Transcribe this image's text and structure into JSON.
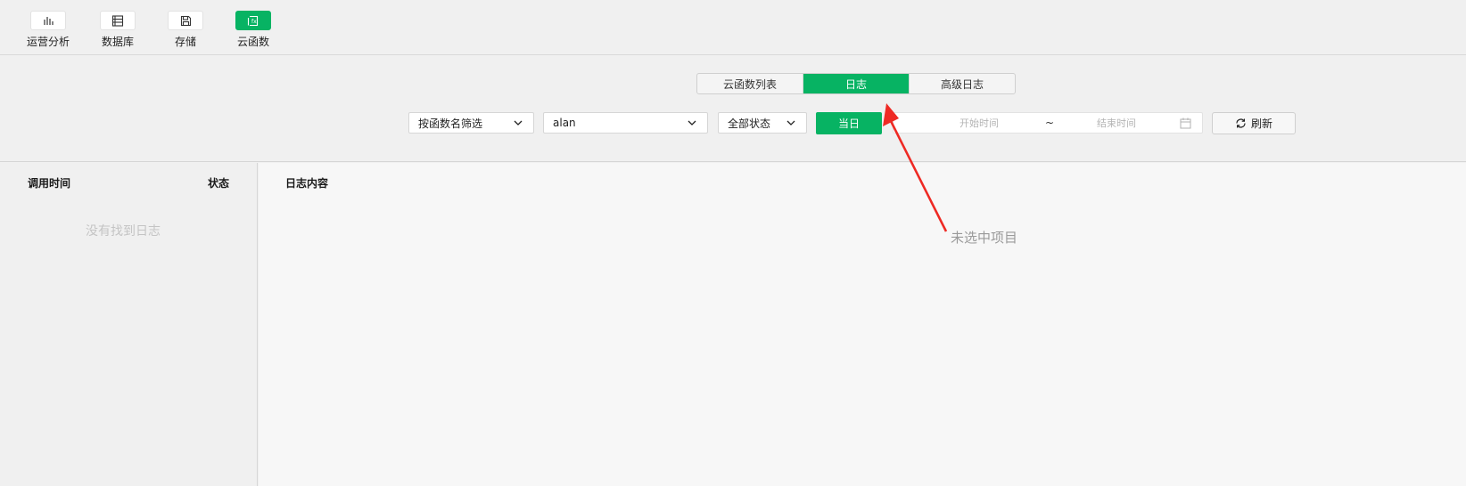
{
  "toolbar": {
    "items": [
      {
        "label": "运营分析",
        "icon": "bar-chart-icon"
      },
      {
        "label": "数据库",
        "icon": "database-icon"
      },
      {
        "label": "存储",
        "icon": "save-icon"
      },
      {
        "label": "云函数",
        "icon": "function-icon",
        "active": true
      }
    ]
  },
  "tabs": {
    "items": [
      {
        "label": "云函数列表"
      },
      {
        "label": "日志",
        "active": true
      },
      {
        "label": "高级日志"
      }
    ]
  },
  "filters": {
    "filter_mode": "按函数名筛选",
    "function_name": "alan",
    "status": "全部状态",
    "today_label": "当日",
    "start_placeholder": "开始时间",
    "range_separator": "~",
    "end_placeholder": "结束时间",
    "refresh_label": "刷新"
  },
  "list_pane": {
    "col_time": "调用时间",
    "col_status": "状态",
    "empty_text": "没有找到日志"
  },
  "detail_pane": {
    "header": "日志内容"
  },
  "annotation": {
    "text": "未选中项目",
    "color": "#ee2a24"
  },
  "colors": {
    "accent": "#07b363"
  }
}
